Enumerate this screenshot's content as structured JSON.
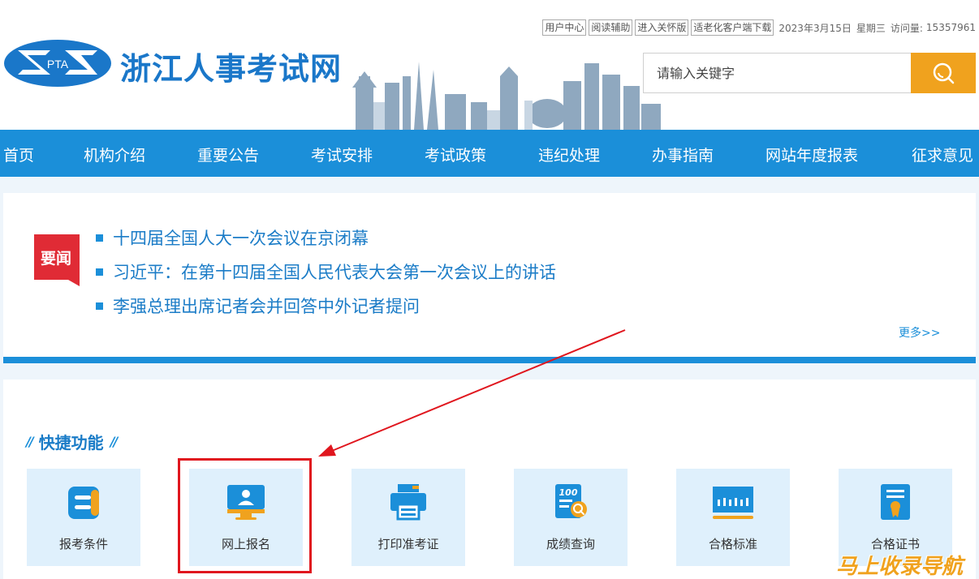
{
  "header": {
    "top_links": [
      "用户中心",
      "阅读辅助",
      "进入关怀版",
      "适老化客户端下载"
    ],
    "date": "2023年3月15日",
    "weekday": "星期三",
    "visit_label": "访问量:",
    "visit_count": "15357961",
    "logo_text": "PTA",
    "site_name": "浙江人事考试网"
  },
  "search": {
    "placeholder": "请输入关键字"
  },
  "nav": {
    "items": [
      "首页",
      "机构介绍",
      "重要公告",
      "考试安排",
      "考试政策",
      "违纪处理",
      "办事指南",
      "网站年度报表",
      "征求意见"
    ]
  },
  "news": {
    "badge": "要闻",
    "items": [
      "十四届全国人大一次会议在京闭幕",
      "习近平：在第十四届全国人民代表大会第一次会议上的讲话",
      "李强总理出席记者会并回答中外记者提问"
    ],
    "more": "更多>>"
  },
  "quick": {
    "title": "快捷功能",
    "deco": "//",
    "tiles": [
      "报考条件",
      "网上报名",
      "打印准考证",
      "成绩查询",
      "合格标准",
      "合格证书"
    ]
  },
  "watermark": "马上收录导航",
  "colors": {
    "brand_blue": "#1b8fd9",
    "accent_orange": "#f0a21e",
    "badge_red": "#e02b35",
    "annotation_red": "#e0161e"
  }
}
